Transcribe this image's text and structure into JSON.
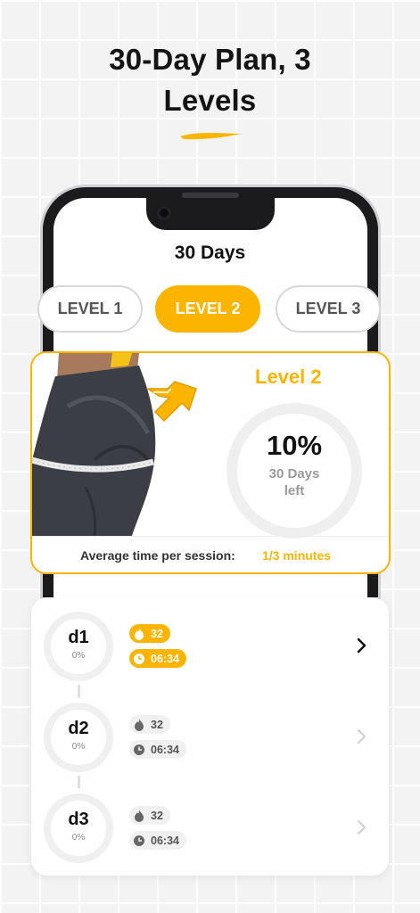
{
  "headline": {
    "line1": "30-Day Plan, 3",
    "line2": "Levels"
  },
  "screen": {
    "title": "30 Days"
  },
  "levels": [
    {
      "label": "LEVEL 1",
      "active": false
    },
    {
      "label": "LEVEL 2",
      "active": true
    },
    {
      "label": "LEVEL 3",
      "active": false
    }
  ],
  "level_card": {
    "name": "Level 2",
    "percent": "10%",
    "days_left_line1": "30 Days",
    "days_left_line2": "left",
    "progress": 0.1,
    "avg_label": "Average time per session:",
    "avg_value": "1/3 minutes"
  },
  "days": [
    {
      "name": "d1",
      "pct": "0%",
      "calories": "32",
      "duration": "06:34",
      "active": true
    },
    {
      "name": "d2",
      "pct": "0%",
      "calories": "32",
      "duration": "06:34",
      "active": false
    },
    {
      "name": "d3",
      "pct": "0%",
      "calories": "32",
      "duration": "06:34",
      "active": false
    }
  ],
  "colors": {
    "accent": "#fbb400",
    "text": "#141414",
    "muted": "#9a9a9a"
  },
  "icons": {
    "calories": "flame-icon",
    "duration": "clock-icon",
    "next": "chevron-right-icon",
    "level_up": "arrow-up-right-icon"
  }
}
